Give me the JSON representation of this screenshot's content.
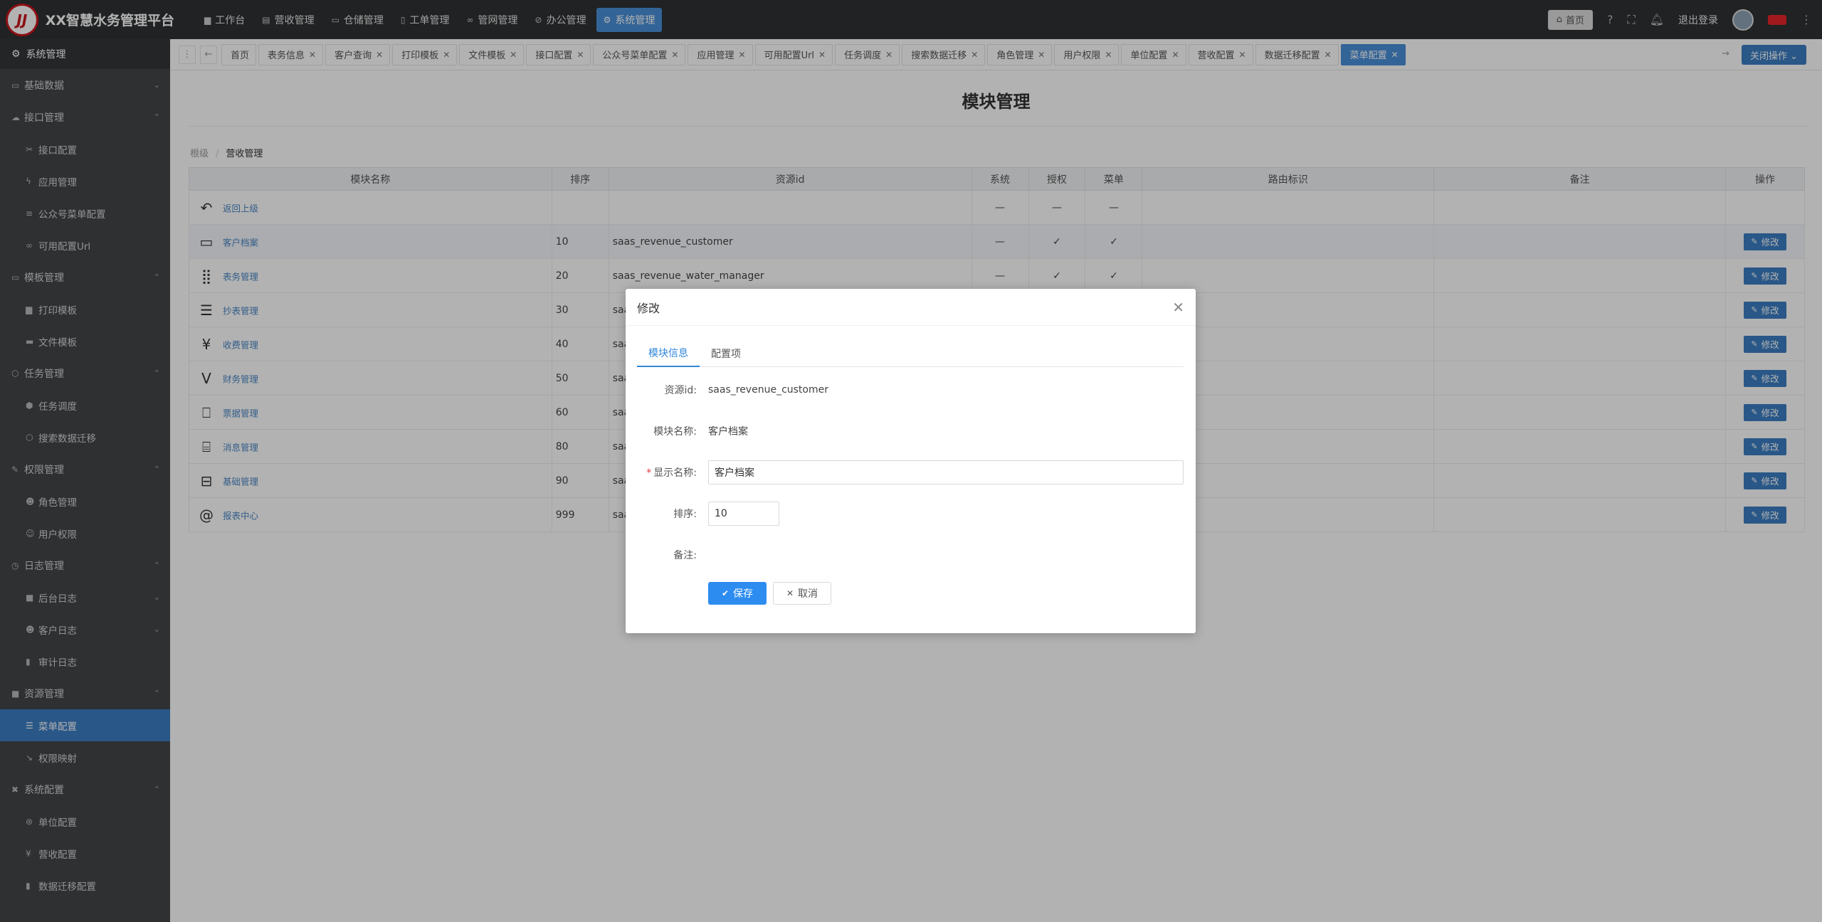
{
  "app": {
    "title": "XX智慧水务管理平台",
    "logo_text": "JJ"
  },
  "topnav": [
    {
      "label": "工作台",
      "icon": "desktop-icon",
      "glyph": "▆"
    },
    {
      "label": "营收管理",
      "icon": "wallet-icon",
      "glyph": "▤"
    },
    {
      "label": "仓储管理",
      "icon": "warehouse-icon",
      "glyph": "▭"
    },
    {
      "label": "工单管理",
      "icon": "clipboard-icon",
      "glyph": "▯"
    },
    {
      "label": "管网管理",
      "icon": "link-icon",
      "glyph": "∞"
    },
    {
      "label": "办公管理",
      "icon": "compass-icon",
      "glyph": "⊘"
    },
    {
      "label": "系统管理",
      "icon": "gear-icon",
      "glyph": "⚙"
    }
  ],
  "topright": {
    "home": "首页",
    "logout": "退出登录"
  },
  "sidebar": {
    "header": "系统管理",
    "items": [
      {
        "label": "基础数据",
        "type": "g",
        "glyph": "▭",
        "arrow": "⌄"
      },
      {
        "label": "接口管理",
        "type": "g",
        "glyph": "☁",
        "arrow": "⌃"
      },
      {
        "label": "接口配置",
        "type": "c",
        "glyph": "✂"
      },
      {
        "label": "应用管理",
        "type": "c",
        "glyph": "ϟ"
      },
      {
        "label": "公众号菜单配置",
        "type": "c",
        "glyph": "≡"
      },
      {
        "label": "可用配置Url",
        "type": "c",
        "glyph": "∞"
      },
      {
        "label": "模板管理",
        "type": "g",
        "glyph": "▭",
        "arrow": "⌃"
      },
      {
        "label": "打印模板",
        "type": "c",
        "glyph": "▆"
      },
      {
        "label": "文件模板",
        "type": "c",
        "glyph": "▬"
      },
      {
        "label": "任务管理",
        "type": "g",
        "glyph": "⬡",
        "arrow": "⌃"
      },
      {
        "label": "任务调度",
        "type": "c",
        "glyph": "⬢"
      },
      {
        "label": "搜索数据迁移",
        "type": "c",
        "glyph": "⬡"
      },
      {
        "label": "权限管理",
        "type": "g",
        "glyph": "✎",
        "arrow": "⌃"
      },
      {
        "label": "角色管理",
        "type": "c",
        "glyph": "☻"
      },
      {
        "label": "用户权限",
        "type": "c",
        "glyph": "☺"
      },
      {
        "label": "日志管理",
        "type": "g",
        "glyph": "◷",
        "arrow": "⌃"
      },
      {
        "label": "后台日志",
        "type": "c",
        "glyph": "■",
        "arrow": "⌄"
      },
      {
        "label": "客户日志",
        "type": "c",
        "glyph": "☻",
        "arrow": "⌄"
      },
      {
        "label": "审计日志",
        "type": "c",
        "glyph": "▮"
      },
      {
        "label": "资源管理",
        "type": "g",
        "glyph": "■",
        "arrow": "⌃"
      },
      {
        "label": "菜单配置",
        "type": "c",
        "glyph": "☰",
        "active": true
      },
      {
        "label": "权限映射",
        "type": "c",
        "glyph": "↘"
      },
      {
        "label": "系统配置",
        "type": "g",
        "glyph": "✖",
        "arrow": "⌃"
      },
      {
        "label": "单位配置",
        "type": "c",
        "glyph": "⊛"
      },
      {
        "label": "营收配置",
        "type": "c",
        "glyph": "¥"
      },
      {
        "label": "数据迁移配置",
        "type": "c",
        "glyph": "▮"
      }
    ]
  },
  "tabs": [
    {
      "label": "首页",
      "closable": false
    },
    {
      "label": "表务信息"
    },
    {
      "label": "客户查询"
    },
    {
      "label": "打印模板"
    },
    {
      "label": "文件模板"
    },
    {
      "label": "接口配置"
    },
    {
      "label": "公众号菜单配置"
    },
    {
      "label": "应用管理"
    },
    {
      "label": "可用配置Url"
    },
    {
      "label": "任务调度"
    },
    {
      "label": "搜索数据迁移"
    },
    {
      "label": "角色管理"
    },
    {
      "label": "用户权限"
    },
    {
      "label": "单位配置"
    },
    {
      "label": "营收配置"
    },
    {
      "label": "数据迁移配置"
    },
    {
      "label": "菜单配置",
      "active": true
    }
  ],
  "close_ops": "关闭操作 ⌄",
  "page": {
    "title": "模块管理",
    "breadcrumb": [
      "根级",
      "营收管理"
    ]
  },
  "table": {
    "headers": [
      "模块名称",
      "排序",
      "资源id",
      "系统",
      "授权",
      "菜单",
      "路由标识",
      "备注",
      "操作"
    ],
    "rows": [
      {
        "icon": "back-arrow-icon",
        "glyph": "↶",
        "name": "返回上级",
        "sort": "",
        "rid": "",
        "sys": "—",
        "auth": "—",
        "menu": "—",
        "route": "",
        "note": "",
        "op": ""
      },
      {
        "icon": "calendar-icon",
        "glyph": "▭",
        "name": "客户档案",
        "sort": "10",
        "rid": "saas_revenue_customer",
        "sys": "—",
        "auth": "✓",
        "menu": "✓",
        "route": "",
        "note": "",
        "op": "修改",
        "hl": true
      },
      {
        "icon": "grid-icon",
        "glyph": "⣿",
        "name": "表务管理",
        "sort": "20",
        "rid": "saas_revenue_water_manager",
        "sys": "—",
        "auth": "✓",
        "menu": "✓",
        "route": "",
        "note": "",
        "op": "修改"
      },
      {
        "icon": "layers-icon",
        "glyph": "☰",
        "name": "抄表管理",
        "sort": "30",
        "rid": "saa",
        "sys": "",
        "auth": "",
        "menu": "",
        "route": "",
        "note": "",
        "op": "修改"
      },
      {
        "icon": "yen-icon",
        "glyph": "¥",
        "name": "收费管理",
        "sort": "40",
        "rid": "saa",
        "sys": "",
        "auth": "",
        "menu": "",
        "route": "",
        "note": "",
        "op": "修改"
      },
      {
        "icon": "vimeo-icon",
        "glyph": "V",
        "name": "财务管理",
        "sort": "50",
        "rid": "saa",
        "sys": "",
        "auth": "",
        "menu": "",
        "route": "",
        "note": "",
        "op": "修改"
      },
      {
        "icon": "book-icon",
        "glyph": "⎕",
        "name": "票据管理",
        "sort": "60",
        "rid": "saa",
        "sys": "",
        "auth": "",
        "menu": "",
        "route": "",
        "note": "",
        "op": "修改"
      },
      {
        "icon": "twitch-icon",
        "glyph": "⌸",
        "name": "消息管理",
        "sort": "80",
        "rid": "saa",
        "sys": "",
        "auth": "",
        "menu": "",
        "route": "",
        "note": "",
        "op": "修改"
      },
      {
        "icon": "briefcase-icon",
        "glyph": "⊟",
        "name": "基础管理",
        "sort": "90",
        "rid": "saa",
        "sys": "",
        "auth": "",
        "menu": "",
        "route": "",
        "note": "",
        "op": "修改"
      },
      {
        "icon": "at-icon",
        "glyph": "@",
        "name": "报表中心",
        "sort": "999",
        "rid": "saa",
        "sys": "",
        "auth": "",
        "menu": "",
        "route": "",
        "note": "",
        "op": "修改"
      }
    ]
  },
  "modal": {
    "title": "修改",
    "tabs": [
      "模块信息",
      "配置项"
    ],
    "fields": {
      "rid_label": "资源id:",
      "rid_value": "saas_revenue_customer",
      "name_label": "模块名称:",
      "name_value": "客户档案",
      "display_label": "显示名称:",
      "display_value": "客户档案",
      "sort_label": "排序:",
      "sort_value": "10",
      "note_label": "备注:"
    },
    "save": "保存",
    "cancel": "取消"
  }
}
